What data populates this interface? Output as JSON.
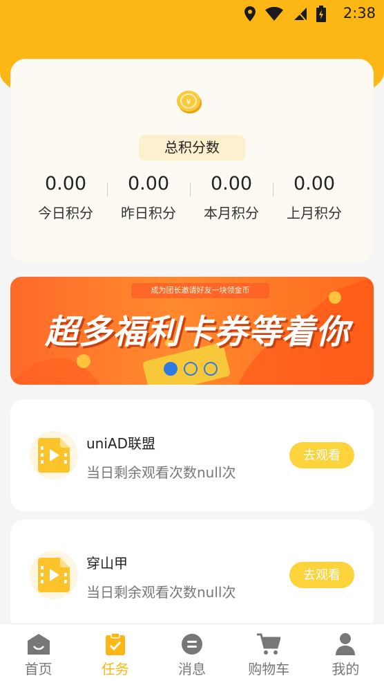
{
  "status_bar": {
    "time": "2:38"
  },
  "points": {
    "total_label": "总积分数",
    "stats": [
      {
        "value": "0.00",
        "label": "今日积分"
      },
      {
        "value": "0.00",
        "label": "昨日积分"
      },
      {
        "value": "0.00",
        "label": "本月积分"
      },
      {
        "value": "0.00",
        "label": "上月积分"
      }
    ]
  },
  "banner": {
    "subtitle": "成为团长邀请好友一块领金币",
    "headline": "超多福利卡券等着你",
    "active_index": 0,
    "count": 3
  },
  "tasks": [
    {
      "title": "uniAD联盟",
      "remaining": "当日剩余观看次数null次",
      "button": "去观看"
    },
    {
      "title": "穿山甲",
      "remaining": "当日剩余观看次数null次",
      "button": "去观看"
    }
  ],
  "tabbar": {
    "items": [
      {
        "label": "首页",
        "icon": "home-icon"
      },
      {
        "label": "任务",
        "icon": "task-icon",
        "active": true
      },
      {
        "label": "消息",
        "icon": "message-icon"
      },
      {
        "label": "购物车",
        "icon": "cart-icon"
      },
      {
        "label": "我的",
        "icon": "profile-icon"
      }
    ]
  },
  "colors": {
    "brand": "#fcb714",
    "button": "#fcd33b",
    "dot": "#2d7be0"
  }
}
